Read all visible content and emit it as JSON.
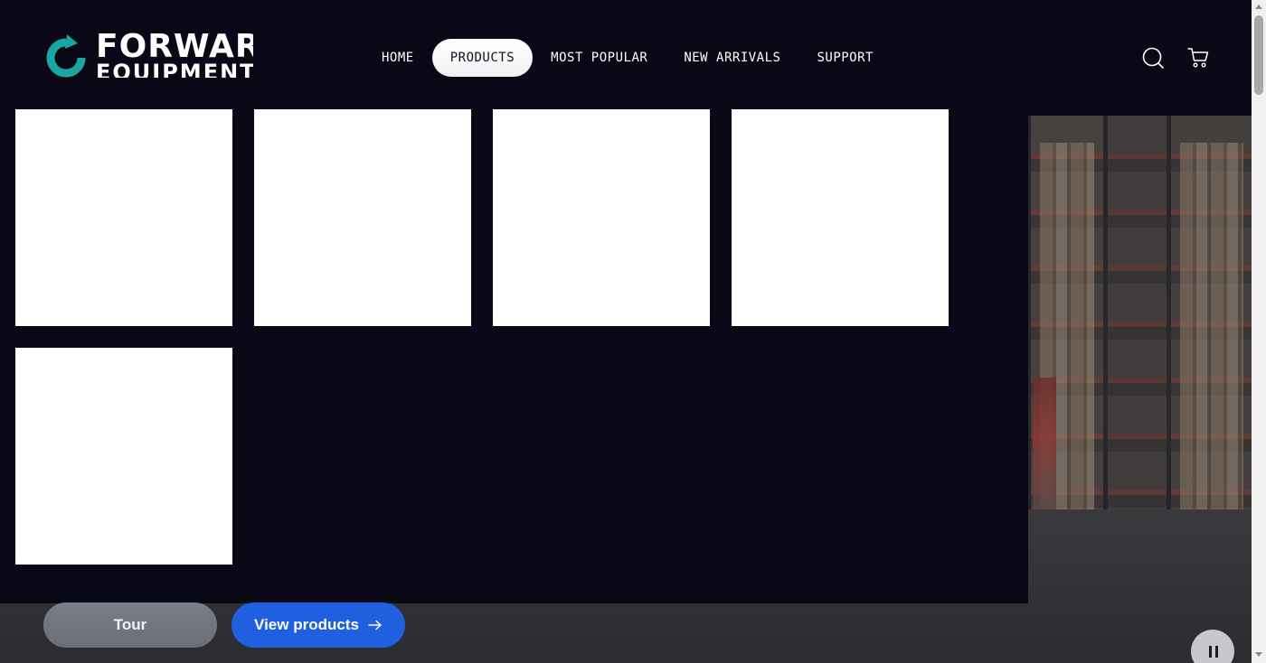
{
  "brand": {
    "logo_text": "FORWARD",
    "logo_subtext": "EQUIPMENT",
    "accent_color": "#1aa6a0"
  },
  "nav": {
    "items": [
      {
        "label": "HOME",
        "active": false
      },
      {
        "label": "PRODUCTS",
        "active": true
      },
      {
        "label": "MOST POPULAR",
        "active": false
      },
      {
        "label": "NEW ARRIVALS",
        "active": false
      },
      {
        "label": "SUPPORT",
        "active": false
      }
    ]
  },
  "header_icons": {
    "search": "search-icon",
    "cart": "cart-icon"
  },
  "mega_menu": {
    "tile_count": 5
  },
  "hero": {
    "tour_label": "Tour",
    "view_products_label": "View products",
    "pause_icon": "pause-icon"
  }
}
